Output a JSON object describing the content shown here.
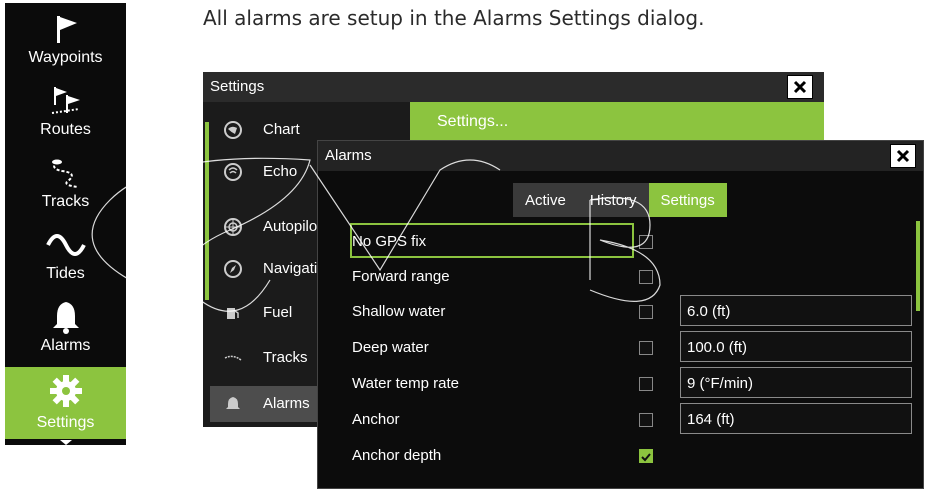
{
  "caption": "All alarms are setup in the Alarms Settings dialog.",
  "side_menu": {
    "items": [
      {
        "label": "Waypoints",
        "icon": "flag-icon"
      },
      {
        "label": "Routes",
        "icon": "route-flags-icon"
      },
      {
        "label": "Tracks",
        "icon": "tracks-icon"
      },
      {
        "label": "Tides",
        "icon": "tide-wave-icon"
      },
      {
        "label": "Alarms",
        "icon": "bell-icon"
      },
      {
        "label": "Settings",
        "icon": "gear-icon"
      }
    ]
  },
  "settings_window": {
    "title": "Settings",
    "close_label": "✕",
    "header_text": "Settings...",
    "categories": [
      {
        "label": "Chart",
        "icon": "chart-icon"
      },
      {
        "label": "Echo",
        "icon": "echo-icon"
      },
      {
        "label": "Autopilo",
        "icon": "autopilot-icon"
      },
      {
        "label": "Navigati",
        "icon": "compass-icon"
      },
      {
        "label": "Fuel",
        "icon": "fuel-icon"
      },
      {
        "label": "Tracks",
        "icon": "tracks-icon"
      },
      {
        "label": "Alarms",
        "icon": "bell-icon"
      }
    ]
  },
  "alarms_dialog": {
    "title": "Alarms",
    "close_label": "✕",
    "tabs": [
      "Active",
      "History",
      "Settings"
    ],
    "active_tab": "Settings",
    "rows": [
      {
        "name": "No GPS fix",
        "checked": false,
        "value": ""
      },
      {
        "name": "Forward range",
        "checked": false,
        "value": ""
      },
      {
        "name": "Shallow water",
        "checked": false,
        "value": "6.0 (ft)"
      },
      {
        "name": "Deep water",
        "checked": false,
        "value": "100.0 (ft)"
      },
      {
        "name": "Water temp rate",
        "checked": false,
        "value": "9 (°F/min)"
      },
      {
        "name": "Anchor",
        "checked": false,
        "value": "164 (ft)"
      },
      {
        "name": "Anchor depth",
        "checked": true,
        "value": ""
      }
    ]
  },
  "colors": {
    "accent": "#8cc43f",
    "background": "#0b0b0b"
  }
}
